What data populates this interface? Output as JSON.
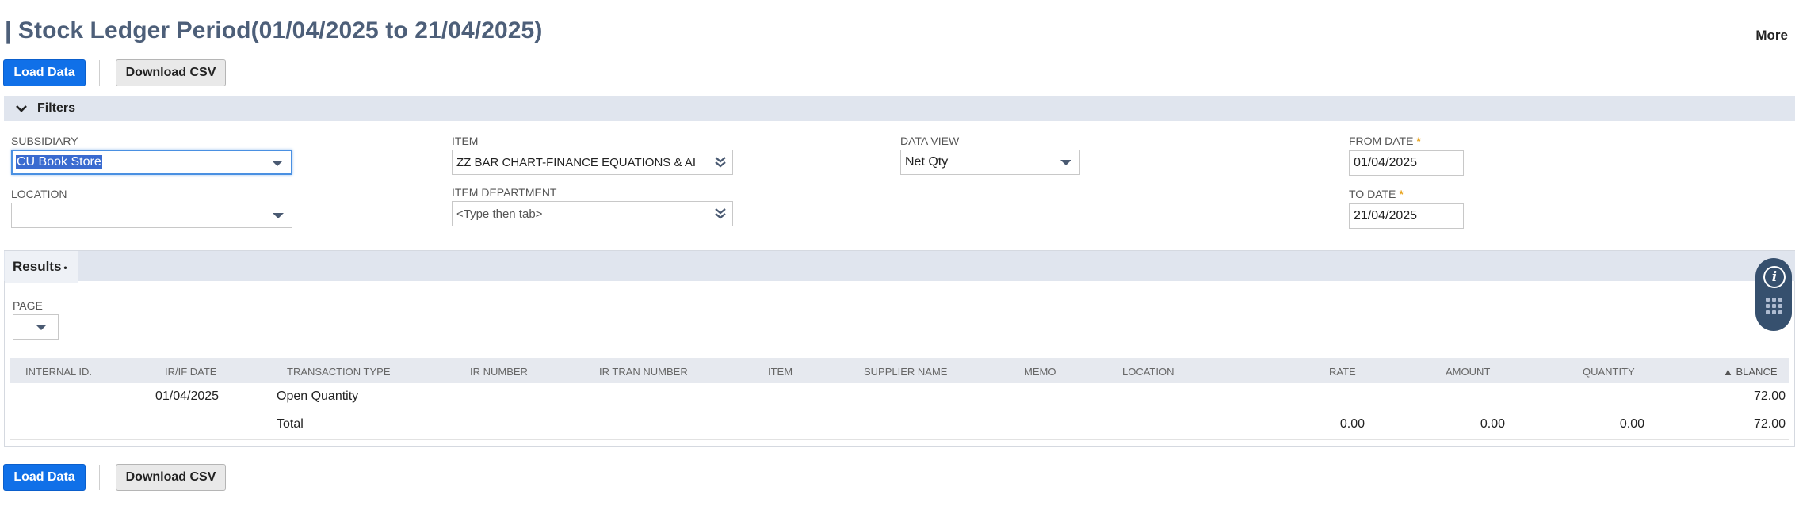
{
  "header": {
    "title": "| Stock Ledger Period(01/04/2025 to 21/04/2025)",
    "more_label": "More"
  },
  "toolbar": {
    "load_data_label": "Load Data",
    "download_csv_label": "Download CSV"
  },
  "filters": {
    "section_label": "Filters",
    "subsidiary": {
      "label": "SUBSIDIARY",
      "value": "CU Book Store"
    },
    "location": {
      "label": "LOCATION",
      "value": ""
    },
    "item": {
      "label": "ITEM",
      "value": "ZZ BAR CHART-FINANCE EQUATIONS & AI"
    },
    "item_department": {
      "label": "ITEM DEPARTMENT",
      "placeholder": "<Type then tab>"
    },
    "data_view": {
      "label": "DATA VIEW",
      "value": "Net Qty"
    },
    "from_date": {
      "label": "FROM DATE",
      "value": "01/04/2025",
      "required": "*"
    },
    "to_date": {
      "label": "TO DATE",
      "value": "21/04/2025",
      "required": "*"
    }
  },
  "results": {
    "tab_label_underlined": "R",
    "tab_label_rest": "esults",
    "tab_marker": "•",
    "page_label": "PAGE",
    "columns": [
      "INTERNAL ID.",
      "IR/IF DATE",
      "TRANSACTION TYPE",
      "IR NUMBER",
      "IR TRAN NUMBER",
      "ITEM",
      "SUPPLIER NAME",
      "MEMO",
      "LOCATION",
      "RATE",
      "AMOUNT",
      "QUANTITY",
      "▲ BLANCE"
    ],
    "rows": [
      {
        "internal_id": "",
        "date": "01/04/2025",
        "transaction_type": "Open Quantity",
        "rate": "",
        "amount": "",
        "quantity": "",
        "balance": "72.00"
      },
      {
        "internal_id": "",
        "date": "",
        "transaction_type": "Total",
        "rate": "0.00",
        "amount": "0.00",
        "quantity": "0.00",
        "balance": "72.00"
      }
    ]
  },
  "colors": {
    "primary_button": "#1070e8",
    "title": "#4d5f79",
    "section_bar": "#e0e5ee",
    "required_star": "#e8a21a",
    "widget": "#36506e"
  },
  "icons": [
    "chevron-down-icon",
    "dropdown-arrow-icon",
    "double-chevron-down-icon",
    "info-icon",
    "grid-dots-icon"
  ]
}
